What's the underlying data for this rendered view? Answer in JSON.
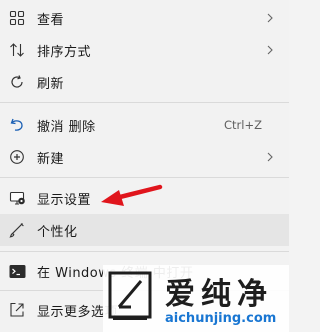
{
  "menu": {
    "items": [
      {
        "label": "查看",
        "icon": "view-icon",
        "submenu": true
      },
      {
        "label": "排序方式",
        "icon": "sort-icon",
        "submenu": true
      },
      {
        "label": "刷新",
        "icon": "refresh-icon"
      },
      {
        "label": "撤消 删除",
        "icon": "undo-icon",
        "shortcut": "Ctrl+Z"
      },
      {
        "label": "新建",
        "icon": "new-icon",
        "submenu": true
      },
      {
        "label": "显示设置",
        "icon": "display-settings-icon"
      },
      {
        "label": "个性化",
        "icon": "personalize-icon"
      },
      {
        "label": "在 Windows 终端 中打开",
        "icon": "terminal-icon"
      },
      {
        "label": "显示更多选项",
        "icon": "more-options-icon"
      }
    ]
  },
  "annotation": {
    "color": "#e0151c"
  },
  "watermark": {
    "title": "爱纯净",
    "url": "aichunjing.com"
  }
}
